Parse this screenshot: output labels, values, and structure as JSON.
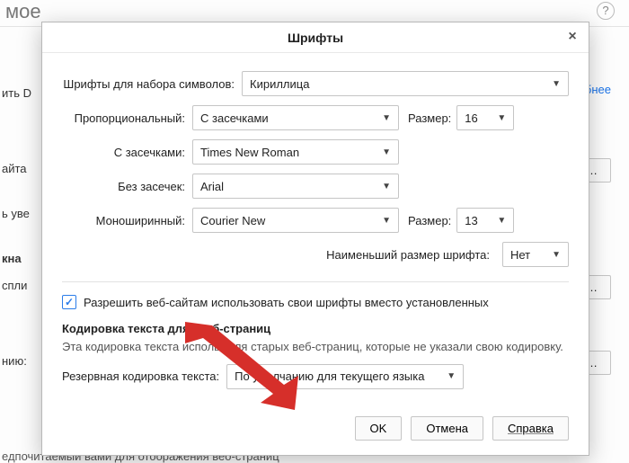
{
  "bg": {
    "page_title_fragment": "мое",
    "link_more": "одробнее",
    "btn_choose": "ыбрать…",
    "btn_exceptions": "чения…",
    "btn_additional": "тельно…",
    "left1": "ить D",
    "left2": "айта",
    "left3": "ь уве",
    "left4": "кна",
    "left5": "спли",
    "left6": "нию:",
    "footer_fragment": "едпочитаемыи вами для отооражения вео-страниц"
  },
  "dlg": {
    "title": "Шрифты",
    "labels": {
      "charset": "Шрифты для набора символов:",
      "proportional": "Пропорциональный:",
      "serif": "С засечками:",
      "sans": "Без засечек:",
      "mono": "Моноширинный:",
      "size": "Размер:",
      "min_size": "Наименьший размер шрифта:",
      "allow_sites": "Разрешить веб-сайтам использовать свои шрифты вместо установленных",
      "legacy_heading": "Кодировка текста для             ых     б-страниц",
      "legacy_desc": "Эта кодировка текста использу           ля старых веб-страниц, которые не указали свою кодировку.",
      "fallback": "Резервная кодировка текста:"
    },
    "values": {
      "charset": "Кириллица",
      "proportional": "С засечками",
      "prop_size": "16",
      "serif": "Times New Roman",
      "sans": "Arial",
      "mono": "Courier New",
      "mono_size": "13",
      "min_size": "Нет",
      "allow_sites_checked": true,
      "fallback": "По умолчанию для текущего языка"
    },
    "buttons": {
      "ok": "OK",
      "cancel": "Отмена",
      "help": "Справка"
    }
  }
}
